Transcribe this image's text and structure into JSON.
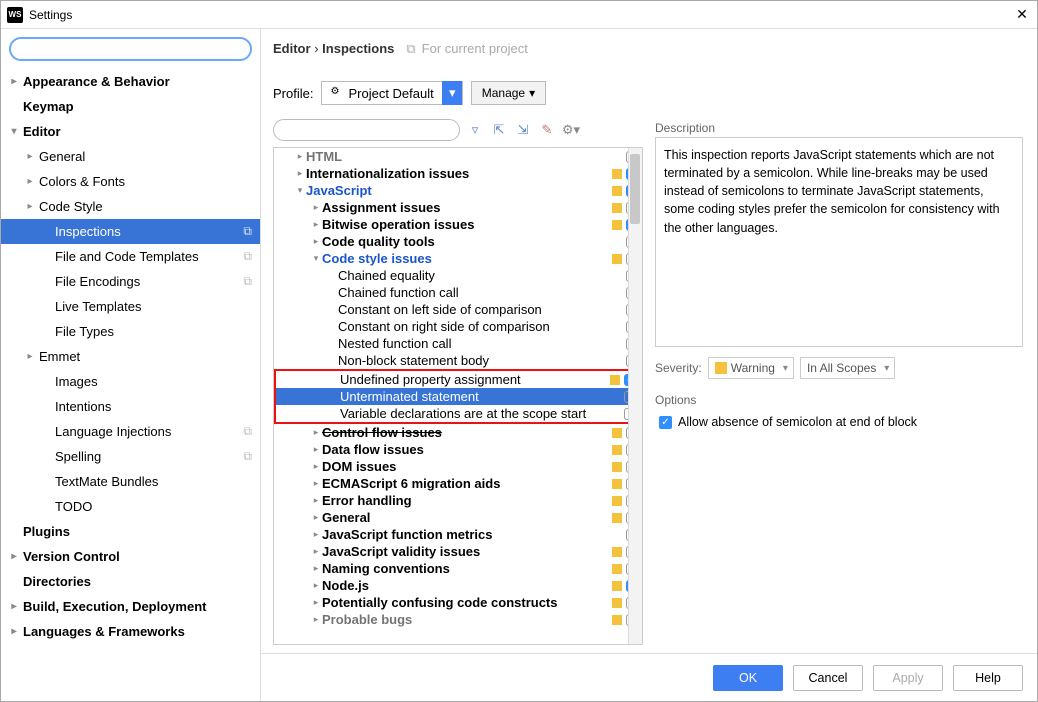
{
  "window": {
    "app_badge": "WS",
    "title": "Settings",
    "close": "✕"
  },
  "sidebar": {
    "search_placeholder": "",
    "items": [
      {
        "label": "Appearance & Behavior",
        "exp": "▸",
        "cls": "top"
      },
      {
        "label": "Keymap",
        "exp": "",
        "cls": "top"
      },
      {
        "label": "Editor",
        "exp": "▾",
        "cls": "top"
      },
      {
        "label": "General",
        "exp": "▸",
        "cls": "ind1"
      },
      {
        "label": "Colors & Fonts",
        "exp": "▸",
        "cls": "ind1"
      },
      {
        "label": "Code Style",
        "exp": "▸",
        "cls": "ind1"
      },
      {
        "label": "Inspections",
        "exp": "",
        "cls": "ind2 sel",
        "copy": true
      },
      {
        "label": "File and Code Templates",
        "exp": "",
        "cls": "ind2",
        "copy": true
      },
      {
        "label": "File Encodings",
        "exp": "",
        "cls": "ind2",
        "copy": true
      },
      {
        "label": "Live Templates",
        "exp": "",
        "cls": "ind2"
      },
      {
        "label": "File Types",
        "exp": "",
        "cls": "ind2"
      },
      {
        "label": "Emmet",
        "exp": "▸",
        "cls": "ind1"
      },
      {
        "label": "Images",
        "exp": "",
        "cls": "ind2"
      },
      {
        "label": "Intentions",
        "exp": "",
        "cls": "ind2"
      },
      {
        "label": "Language Injections",
        "exp": "",
        "cls": "ind2",
        "copy": true
      },
      {
        "label": "Spelling",
        "exp": "",
        "cls": "ind2",
        "copy": true
      },
      {
        "label": "TextMate Bundles",
        "exp": "",
        "cls": "ind2"
      },
      {
        "label": "TODO",
        "exp": "",
        "cls": "ind2"
      },
      {
        "label": "Plugins",
        "exp": "",
        "cls": "top"
      },
      {
        "label": "Version Control",
        "exp": "▸",
        "cls": "top"
      },
      {
        "label": "Directories",
        "exp": "",
        "cls": "top"
      },
      {
        "label": "Build, Execution, Deployment",
        "exp": "▸",
        "cls": "top"
      },
      {
        "label": "Languages & Frameworks",
        "exp": "▸",
        "cls": "top"
      }
    ]
  },
  "breadcrumb": {
    "seg1": "Editor",
    "sep": "›",
    "seg2": "Inspections",
    "hint": "For current project"
  },
  "profile": {
    "label": "Profile:",
    "value": "Project Default",
    "manage": "Manage"
  },
  "toolbar_icons": [
    "funnel-icon",
    "expand-all-icon",
    "collapse-all-icon",
    "reset-icon",
    "gear-icon"
  ],
  "tree": [
    {
      "lv": 1,
      "exp": "▸",
      "lbl": "HTML",
      "bold": true,
      "ind": "none",
      "cb": "off",
      "cut": true
    },
    {
      "lv": 1,
      "exp": "▸",
      "lbl": "Internationalization issues",
      "bold": true,
      "ind": "y",
      "cb": "on"
    },
    {
      "lv": 1,
      "exp": "▾",
      "lbl": "JavaScript",
      "link": true,
      "ind": "y",
      "cb": "on"
    },
    {
      "lv": 2,
      "exp": "▸",
      "lbl": "Assignment issues",
      "bold": true,
      "ind": "y",
      "cb": "off"
    },
    {
      "lv": 2,
      "exp": "▸",
      "lbl": "Bitwise operation issues",
      "bold": true,
      "ind": "y",
      "cb": "on"
    },
    {
      "lv": 2,
      "exp": "▸",
      "lbl": "Code quality tools",
      "bold": true,
      "ind": "none",
      "cb": "off"
    },
    {
      "lv": 2,
      "exp": "▾",
      "lbl": "Code style issues",
      "link": true,
      "ind": "y",
      "cb": "off"
    },
    {
      "lv": 3,
      "exp": "",
      "lbl": "Chained equality",
      "ind": "none",
      "cb": "off"
    },
    {
      "lv": 3,
      "exp": "",
      "lbl": "Chained function call",
      "ind": "none",
      "cb": "off"
    },
    {
      "lv": 3,
      "exp": "",
      "lbl": "Constant on left side of comparison",
      "ind": "none",
      "cb": "off"
    },
    {
      "lv": 3,
      "exp": "",
      "lbl": "Constant on right side of comparison",
      "ind": "none",
      "cb": "off"
    },
    {
      "lv": 3,
      "exp": "",
      "lbl": "Nested function call",
      "ind": "none",
      "cb": "off"
    },
    {
      "lv": 3,
      "exp": "",
      "lbl": "Non-block statement body",
      "ind": "none",
      "cb": "off"
    },
    {
      "lv": 3,
      "exp": "",
      "lbl": "Undefined property assignment",
      "ind": "y",
      "cb": "on",
      "red": "start"
    },
    {
      "lv": 3,
      "exp": "",
      "lbl": "Unterminated statement",
      "sel": true,
      "ind": "none",
      "cb": "off",
      "red": "mid"
    },
    {
      "lv": 3,
      "exp": "",
      "lbl": "Variable declarations are at the scope start",
      "ind": "none",
      "cb": "off",
      "red": "end"
    },
    {
      "lv": 2,
      "exp": "▸",
      "lbl": "Control flow issues",
      "bold": true,
      "ind": "y",
      "cb": "off",
      "strike": true
    },
    {
      "lv": 2,
      "exp": "▸",
      "lbl": "Data flow issues",
      "bold": true,
      "ind": "y",
      "cb": "off"
    },
    {
      "lv": 2,
      "exp": "▸",
      "lbl": "DOM issues",
      "bold": true,
      "ind": "y",
      "cb": "off"
    },
    {
      "lv": 2,
      "exp": "▸",
      "lbl": "ECMAScript 6 migration aids",
      "bold": true,
      "ind": "y",
      "cb": "off"
    },
    {
      "lv": 2,
      "exp": "▸",
      "lbl": "Error handling",
      "bold": true,
      "ind": "y",
      "cb": "off"
    },
    {
      "lv": 2,
      "exp": "▸",
      "lbl": "General",
      "bold": true,
      "ind": "y",
      "cb": "off"
    },
    {
      "lv": 2,
      "exp": "▸",
      "lbl": "JavaScript function metrics",
      "bold": true,
      "ind": "none",
      "cb": "off"
    },
    {
      "lv": 2,
      "exp": "▸",
      "lbl": "JavaScript validity issues",
      "bold": true,
      "ind": "y",
      "cb": "off"
    },
    {
      "lv": 2,
      "exp": "▸",
      "lbl": "Naming conventions",
      "bold": true,
      "ind": "y",
      "cb": "off"
    },
    {
      "lv": 2,
      "exp": "▸",
      "lbl": "Node.js",
      "bold": true,
      "ind": "y",
      "cb": "on"
    },
    {
      "lv": 2,
      "exp": "▸",
      "lbl": "Potentially confusing code constructs",
      "bold": true,
      "ind": "y",
      "cb": "mixed"
    },
    {
      "lv": 2,
      "exp": "▸",
      "lbl": "Probable bugs",
      "bold": true,
      "ind": "y",
      "cb": "off",
      "cut": true
    }
  ],
  "description": {
    "label": "Description",
    "text": "This inspection reports JavaScript statements which are not terminated by a semicolon. While line-breaks may be used instead of semicolons to terminate JavaScript statements, some coding styles prefer the semicolon for consistency with the other languages."
  },
  "severity": {
    "label": "Severity:",
    "value": "Warning",
    "scope": "In All Scopes"
  },
  "options": {
    "label": "Options",
    "checkbox_label": "Allow absence of semicolon at end of block",
    "checked": true
  },
  "footer": {
    "ok": "OK",
    "cancel": "Cancel",
    "apply": "Apply",
    "help": "Help"
  }
}
